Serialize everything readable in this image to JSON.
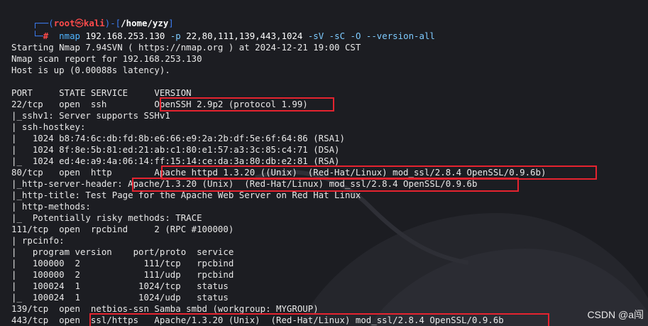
{
  "prompt": {
    "corner_top": "┌──(",
    "user": "root",
    "at_symbol": "㉿",
    "host": "kali",
    "sep": ")-[",
    "path": "/home/yzy",
    "close": "]",
    "corner_bottom": "└─",
    "hash": "#",
    "command": "nmap",
    "target": "192.168.253.130",
    "flag_p": "-p",
    "ports": "22,80,111,139,443,1024",
    "options": "-sV -sC -O --version-all"
  },
  "output_lines": [
    "Starting Nmap 7.94SVN ( https://nmap.org ) at 2024-12-21 19:00 CST",
    "Nmap scan report for 192.168.253.130",
    "Host is up (0.00088s latency).",
    "",
    "PORT     STATE SERVICE     VERSION",
    "22/tcp   open  ssh         OpenSSH 2.9p2 (protocol 1.99)",
    "|_sshv1: Server supports SSHv1",
    "| ssh-hostkey: ",
    "|   1024 b8:74:6c:db:fd:8b:e6:66:e9:2a:2b:df:5e:6f:64:86 (RSA1)",
    "|   1024 8f:8e:5b:81:ed:21:ab:c1:80:e1:57:a3:3c:85:c4:71 (DSA)",
    "|_  1024 ed:4e:a9:4a:06:14:ff:15:14:ce:da:3a:80:db:e2:81 (RSA)",
    "80/tcp   open  http        Apache httpd 1.3.20 ((Unix)  (Red-Hat/Linux) mod_ssl/2.8.4 OpenSSL/0.9.6b)",
    "|_http-server-header: Apache/1.3.20 (Unix)  (Red-Hat/Linux) mod_ssl/2.8.4 OpenSSL/0.9.6b",
    "|_http-title: Test Page for the Apache Web Server on Red Hat Linux",
    "| http-methods: ",
    "|_  Potentially risky methods: TRACE",
    "111/tcp  open  rpcbind     2 (RPC #100000)",
    "| rpcinfo: ",
    "|   program version    port/proto  service",
    "|   100000  2            111/tcp   rpcbind",
    "|   100000  2            111/udp   rpcbind",
    "|   100024  1           1024/tcp   status",
    "|_  100024  1           1024/udp   status",
    "139/tcp  open  netbios-ssn Samba smbd (workgroup: MYGROUP)",
    "443/tcp  open  ssl/https   Apache/1.3.20 (Unix)  (Red-Hat/Linux) mod_ssl/2.8.4 OpenSSL/0.9.6b"
  ],
  "watermark": "CSDN @a闯",
  "colors": {
    "background": "#1c1d22",
    "highlight_box": "#e5232f",
    "prompt_blue": "#3d7ef5",
    "prompt_red": "#ff4b4b"
  }
}
